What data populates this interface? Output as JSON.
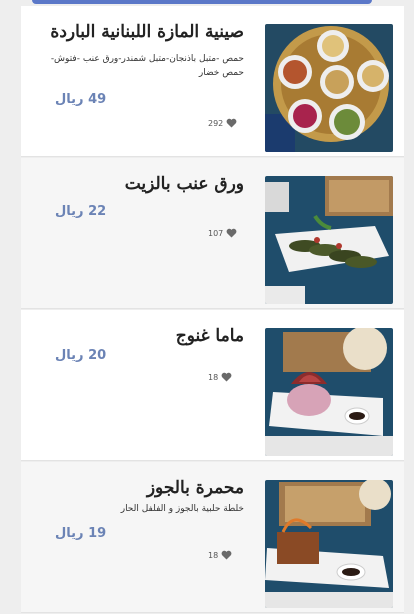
{
  "items": [
    {
      "title": "صينية المازة اللبنانية الباردة",
      "description": "حمص -متبل باذنجان-متبل شمندر-ورق عنب -فتوش-حمص خضار",
      "price": "49 ريال",
      "likes": "292"
    },
    {
      "title": "ورق عنب بالزيت",
      "description": "",
      "price": "22 ريال",
      "likes": "107"
    },
    {
      "title": "ماما غنوج",
      "description": "",
      "price": "20 ريال",
      "likes": "18"
    },
    {
      "title": "محمرة بالجوز",
      "description": "خلطة حلبية بالجوز و الفلفل الحار",
      "price": "19 ريال",
      "likes": "18"
    }
  ],
  "icons": {
    "like": "heart-icon",
    "image": "food-photo"
  },
  "colors": {
    "accent": "#5b78c8",
    "price": "#6b83b5"
  }
}
